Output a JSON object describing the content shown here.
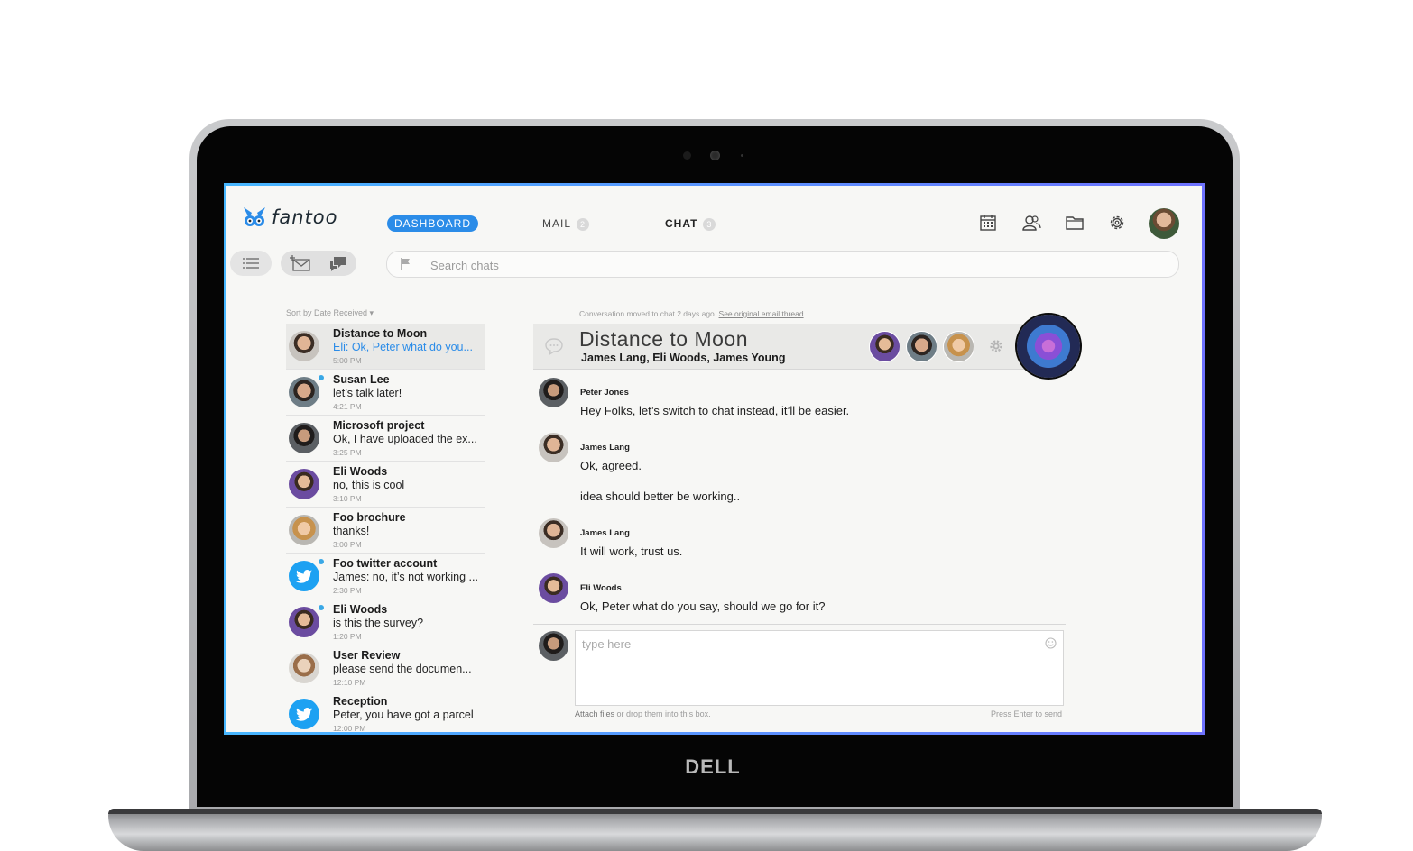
{
  "device": {
    "brand": "DELL"
  },
  "app": {
    "brand": "fantoo",
    "nav": {
      "dashboard": "DASHBOARD",
      "mail": "MAIL",
      "mail_count": "2",
      "chat": "CHAT",
      "chat_count": "3"
    },
    "top_icons": [
      "calendar-icon",
      "contacts-icon",
      "folder-icon",
      "settings-icon"
    ],
    "search": {
      "placeholder": "Search chats"
    },
    "sort_label": "Sort by Date Received ▾",
    "conversations": [
      {
        "title": "Distance to Moon",
        "preview": "Eli: Ok, Peter what do you...",
        "time": "5:00 PM",
        "unread": false,
        "active": true,
        "avatar": "p1"
      },
      {
        "title": "Susan Lee",
        "preview": "let’s talk later!",
        "time": "4:21 PM",
        "unread": true,
        "active": false,
        "avatar": "p2"
      },
      {
        "title": "Microsoft project",
        "preview": "Ok, I have uploaded the ex...",
        "time": "3:25 PM",
        "unread": false,
        "active": false,
        "avatar": "p3"
      },
      {
        "title": "Eli Woods",
        "preview": "no, this is cool",
        "time": "3:10 PM",
        "unread": false,
        "active": false,
        "avatar": "p4"
      },
      {
        "title": "Foo brochure",
        "preview": "thanks!",
        "time": "3:00 PM",
        "unread": false,
        "active": false,
        "avatar": "p5"
      },
      {
        "title": "Foo twitter account",
        "preview": "James: no, it’s not working ...",
        "time": "2:30 PM",
        "unread": true,
        "active": false,
        "avatar": "tw"
      },
      {
        "title": "Eli Woods",
        "preview": "is this the survey?",
        "time": "1:20 PM",
        "unread": true,
        "active": false,
        "avatar": "p4"
      },
      {
        "title": "User Review",
        "preview": "please send the documen...",
        "time": "12:10 PM",
        "unread": false,
        "active": false,
        "avatar": "p6"
      },
      {
        "title": "Reception",
        "preview": "Peter, you have got a parcel",
        "time": "12:00 PM",
        "unread": false,
        "active": false,
        "avatar": "tw"
      }
    ],
    "chat": {
      "moved_notice": "Conversation moved to chat 2 days ago.",
      "moved_link": "See original email thread",
      "title": "Distance to Moon",
      "members": "James Lang, Eli Woods, James Young",
      "messages": [
        {
          "author": "Peter Jones",
          "lines": [
            "Hey Folks, let’s switch to chat instead, it’ll be easier."
          ]
        },
        {
          "author": "James Lang",
          "lines": [
            "Ok, agreed.",
            "idea should better be working.."
          ]
        },
        {
          "author": "James Lang",
          "lines": [
            "It will work, trust us."
          ]
        },
        {
          "author": "Eli Woods",
          "lines": [
            "Ok, Peter what do you say, should we go for it?"
          ]
        }
      ],
      "compose_placeholder": "type here",
      "attach_link": "Attach files",
      "attach_text": " or drop them into this box.",
      "enter_hint": "Press Enter to send"
    },
    "colors": {
      "accent": "#2b8ce8",
      "unread_dot": "#3aa8e6",
      "twitter": "#1da1f2",
      "screen_border": "#47b7ff"
    }
  }
}
